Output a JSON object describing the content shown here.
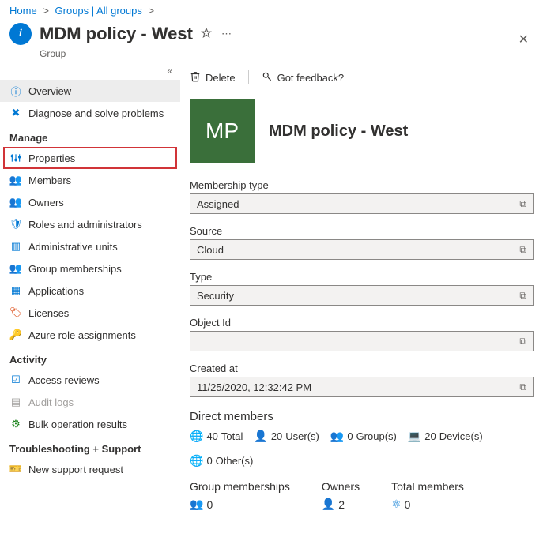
{
  "breadcrumb": {
    "home": "Home",
    "groups": "Groups | All groups"
  },
  "header": {
    "title": "MDM policy - West",
    "subtitle": "Group"
  },
  "sidebar": {
    "overview": "Overview",
    "diagnose": "Diagnose and solve problems",
    "section_manage": "Manage",
    "properties": "Properties",
    "members": "Members",
    "owners": "Owners",
    "roles": "Roles and administrators",
    "admin_units": "Administrative units",
    "group_memberships": "Group memberships",
    "applications": "Applications",
    "licenses": "Licenses",
    "azure_roles": "Azure role assignments",
    "section_activity": "Activity",
    "access_reviews": "Access reviews",
    "audit_logs": "Audit logs",
    "bulk": "Bulk operation results",
    "section_trouble": "Troubleshooting + Support",
    "support": "New support request"
  },
  "toolbar": {
    "delete": "Delete",
    "feedback": "Got feedback?"
  },
  "hero": {
    "initials": "MP",
    "title": "MDM policy - West"
  },
  "fields": {
    "membership_type": {
      "label": "Membership type",
      "value": "Assigned"
    },
    "source": {
      "label": "Source",
      "value": "Cloud"
    },
    "type": {
      "label": "Type",
      "value": "Security"
    },
    "object_id": {
      "label": "Object Id",
      "value": ""
    },
    "created_at": {
      "label": "Created at",
      "value": "11/25/2020, 12:32:42 PM"
    }
  },
  "direct_members": {
    "title": "Direct members",
    "total": {
      "count": "40",
      "label": "Total"
    },
    "users": {
      "count": "20",
      "label": "User(s)"
    },
    "groups": {
      "count": "0",
      "label": "Group(s)"
    },
    "devices": {
      "count": "20",
      "label": "Device(s)"
    },
    "others": {
      "count": "0",
      "label": "Other(s)"
    }
  },
  "summary": {
    "group_memberships": {
      "title": "Group memberships",
      "count": "0"
    },
    "owners": {
      "title": "Owners",
      "count": "2"
    },
    "total_members": {
      "title": "Total members",
      "count": "0"
    }
  }
}
